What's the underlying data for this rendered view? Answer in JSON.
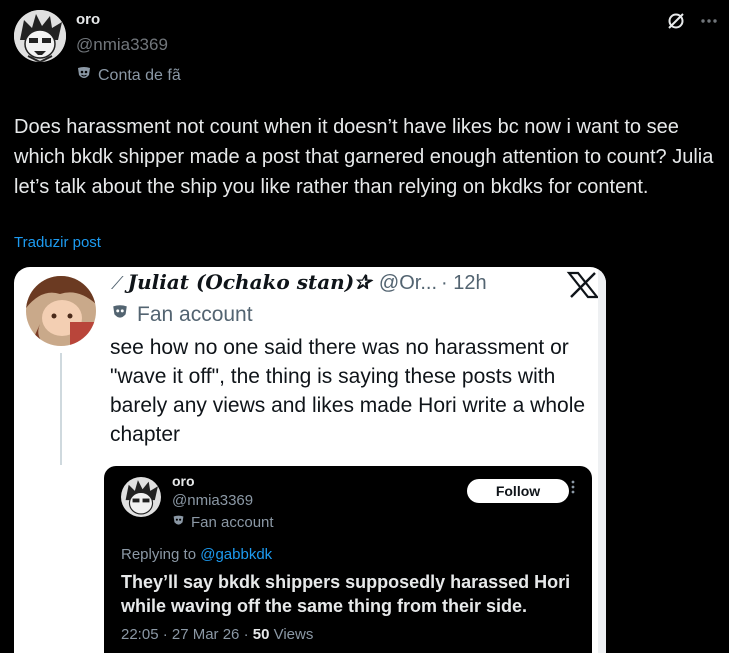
{
  "post": {
    "author_name": "oro",
    "author_handle": "@nmia3369",
    "badge": "Conta de fã",
    "text": "Does harassment not count when it doesn’t have likes bc now i want to see which bkdk shipper made a post that garnered enough attention to count? Julia let’s talk about the ship you like rather than relying on bkdks for content.",
    "translate": "Traduzir post"
  },
  "embed": {
    "name": "Juliat (Ochako stan)✰",
    "handle": "@Or...",
    "time": "· 12h",
    "badge": "Fan account",
    "text": "see how no one said there was no harassment or \"wave it off\", the thing is saying these posts with barely any views and likes made Hori write a whole chapter",
    "x_logo": "X"
  },
  "quoted": {
    "name": "oro",
    "handle": "@nmia3369",
    "badge": "Fan account",
    "follow": "Follow",
    "replying_prefix": "Replying to",
    "replying_to": "@gabbkdk",
    "text": "They’ll say bkdk shippers supposedly harassed Hori while waving off the same thing from their side.",
    "meta_time": "22:05 · 27 Mar 26 ·",
    "meta_views_count": "50",
    "meta_views_label": "Views"
  },
  "icons": [
    "grok-icon",
    "more-icon",
    "mask-icon",
    "x-logo-icon"
  ],
  "colors": {
    "link": "#1d9bf0",
    "muted": "#71767b",
    "text": "#e7e9ea"
  }
}
